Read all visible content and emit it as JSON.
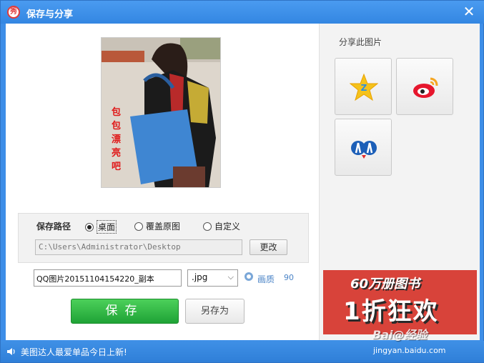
{
  "window": {
    "title": "保存与分享",
    "logo_text": "秀"
  },
  "preview": {
    "caption": "包包漂亮吧"
  },
  "save_path": {
    "label": "保存路径",
    "options": [
      {
        "label": "桌面",
        "checked": true
      },
      {
        "label": "覆盖原图",
        "checked": false
      },
      {
        "label": "自定义",
        "checked": false
      }
    ],
    "path_value": "C:\\Users\\Administrator\\Desktop",
    "change_label": "更改"
  },
  "file": {
    "name": "QQ图片20151104154220_副本",
    "extension": ".jpg",
    "quality_label": "画质",
    "quality_value": "90"
  },
  "actions": {
    "save_label": "保存",
    "save_as_label": "另存为"
  },
  "share": {
    "title": "分享此图片",
    "buttons": [
      {
        "icon": "qzone-icon"
      },
      {
        "icon": "weibo-icon"
      },
      {
        "icon": "renren-icon"
      }
    ]
  },
  "ad": {
    "line1": "60万册图书",
    "line2": "1折狂欢"
  },
  "status": {
    "message": "美图达人最爱单品今日上新!"
  },
  "watermark": {
    "brand": "Bai@经验",
    "url": "jingyan.baidu.com"
  },
  "colors": {
    "title_bar": "#3d8ee8",
    "save_button": "#2db844",
    "ad_background": "#d8433a",
    "caption": "#e01818"
  }
}
